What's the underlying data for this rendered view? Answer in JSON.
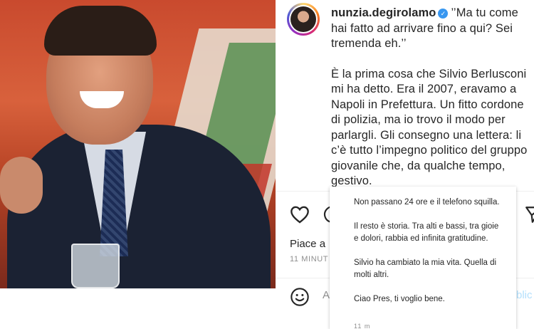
{
  "post": {
    "username": "nunzia.degirolamo",
    "caption_paragraphs": [
      "’’Ma tu come hai fatto ad arrivare fino a qui? Sei tremenda eh.’’",
      "È la prima cosa che Silvio Berlusconi mi ha detto. Era il 2007, eravamo a Napoli in Prefettura. Un fitto cordone di polizia, ma io trovo il modo per parlargli. Gli consegno una lettera: li c’è tutto l’impegno politico del gruppo giovanile che, da qualche tempo, gestivo."
    ],
    "likes_text": "Piace a",
    "time_text": "11 MINUT",
    "add_comment_placeholder": "A",
    "publish_label": "blic"
  },
  "overlay": {
    "paragraphs": [
      "Non passano 24 ore e il telefono squilla.",
      "Il resto è storia. Tra alti e bassi, tra gioie e dolori, rabbia ed infinita gratitudine.",
      "Silvio ha cambiato la mia vita. Quella di molti altri.",
      "Ciao Pres, ti voglio bene."
    ],
    "time_text": "11 m"
  },
  "icons": {
    "verified": "verified-badge-icon",
    "heart": "heart-icon",
    "comment": "comment-icon",
    "share": "share-icon",
    "emoji": "emoji-icon"
  },
  "colors": {
    "verified_blue": "#3897f0",
    "publish_disabled": "#b2dffc",
    "secondary_text": "#8e8e8e"
  }
}
